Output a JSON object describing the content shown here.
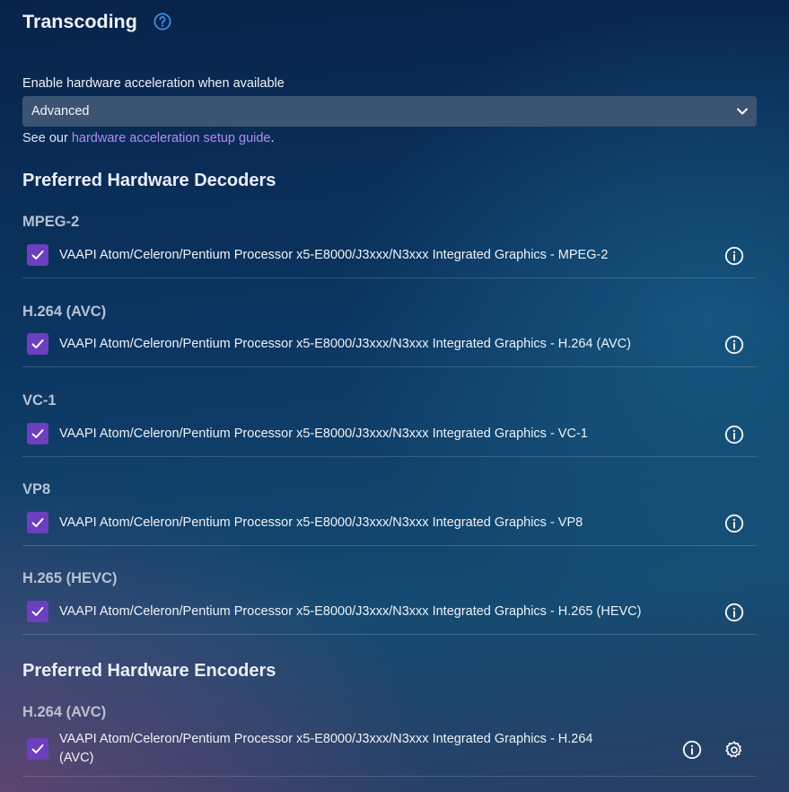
{
  "page": {
    "title": "Transcoding",
    "help_icon": "help-circle-icon"
  },
  "hw_accel": {
    "label": "Enable hardware acceleration when available",
    "selected": "Advanced",
    "guide_prefix": "See our ",
    "guide_link": "hardware acceleration setup guide",
    "guide_suffix": "."
  },
  "decoders": {
    "heading": "Preferred Hardware Decoders",
    "items": [
      {
        "codec": "MPEG-2",
        "label": "VAAPI Atom/Celeron/Pentium Processor x5-E8000/J3xxx/N3xxx Integrated Graphics - MPEG-2",
        "checked": true
      },
      {
        "codec": "H.264 (AVC)",
        "label": "VAAPI Atom/Celeron/Pentium Processor x5-E8000/J3xxx/N3xxx Integrated Graphics - H.264 (AVC)",
        "checked": true
      },
      {
        "codec": "VC-1",
        "label": "VAAPI Atom/Celeron/Pentium Processor x5-E8000/J3xxx/N3xxx Integrated Graphics - VC-1",
        "checked": true
      },
      {
        "codec": "VP8",
        "label": "VAAPI Atom/Celeron/Pentium Processor x5-E8000/J3xxx/N3xxx Integrated Graphics - VP8",
        "checked": true
      },
      {
        "codec": "H.265 (HEVC)",
        "label": "VAAPI Atom/Celeron/Pentium Processor x5-E8000/J3xxx/N3xxx Integrated Graphics - H.265 (HEVC)",
        "checked": true
      }
    ]
  },
  "encoders": {
    "heading": "Preferred Hardware Encoders",
    "items": [
      {
        "codec": "H.264 (AVC)",
        "label_line1": "VAAPI Atom/Celeron/Pentium Processor x5-E8000/J3xxx/N3xxx Integrated Graphics - H.264",
        "label_line2": "(AVC)",
        "checked": true
      }
    ]
  },
  "colors": {
    "accent": "#6b3fbf",
    "link": "#b18cf0",
    "help_icon": "#3d8fe0",
    "select_bg": "#3b5472"
  }
}
